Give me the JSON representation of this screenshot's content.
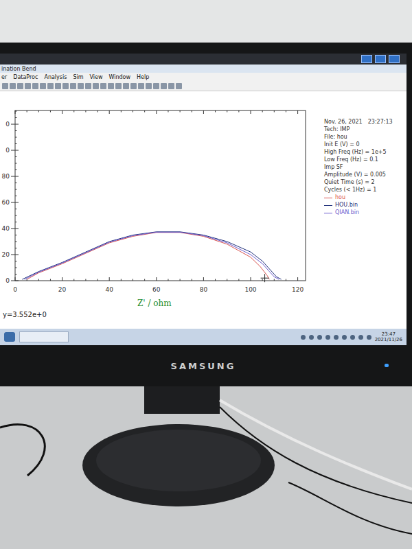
{
  "window": {
    "title": "ination  Bend"
  },
  "menu": [
    "er",
    "DataProc",
    "Analysis",
    "Sim",
    "View",
    "Window",
    "Help"
  ],
  "chart": {
    "y_ticks": [
      "0",
      "0",
      "80",
      "60",
      "40",
      "20",
      "0"
    ],
    "x_ticks": [
      "0",
      "20",
      "40",
      "60",
      "80",
      "100",
      "120"
    ],
    "x_label": "Z' / ohm",
    "series": [
      {
        "name": "hou",
        "color": "#d9534f",
        "x": [
          5,
          10,
          20,
          30,
          40,
          50,
          60,
          70,
          80,
          90,
          100,
          104,
          107,
          108
        ],
        "y": [
          1,
          6,
          13,
          21,
          29,
          34,
          37,
          37,
          34,
          28,
          18,
          11,
          4,
          1
        ]
      },
      {
        "name": "HOU.bin",
        "color": "#1f2f7a",
        "x": [
          3,
          10,
          20,
          30,
          40,
          50,
          60,
          70,
          80,
          90,
          100,
          105,
          108,
          111,
          113
        ],
        "y": [
          1,
          7,
          14,
          22,
          30,
          35,
          37.5,
          37.5,
          35,
          30,
          22,
          15,
          9,
          3,
          1
        ]
      },
      {
        "name": "QIAN.bin",
        "color": "#6a5acd",
        "x": [
          4,
          10,
          20,
          30,
          40,
          50,
          60,
          70,
          80,
          90,
          100,
          105,
          108,
          110,
          112
        ],
        "y": [
          1,
          6.5,
          13.5,
          21.5,
          29.5,
          34.5,
          37.2,
          37.2,
          34.5,
          29,
          20,
          13,
          7,
          3,
          1
        ]
      }
    ],
    "cursor": {
      "x": 106,
      "y": 2
    }
  },
  "info": {
    "date": "Nov. 26, 2021",
    "time": "23:27:13",
    "lines": [
      "Tech: IMP",
      "File: hou",
      "Init E (V) = 0",
      "High Freq (Hz) = 1e+5",
      "Low Freq (Hz) = 0.1",
      "Imp SF",
      "Amplitude (V) = 0.005",
      "Quiet Time (s) = 2",
      "Cycles (< 1Hz) = 1"
    ]
  },
  "status": "y=3.552e+0",
  "taskbar": {
    "time": "23:47",
    "date": "2021/11/26"
  },
  "monitor": {
    "brand": "SAMSUNG"
  }
}
